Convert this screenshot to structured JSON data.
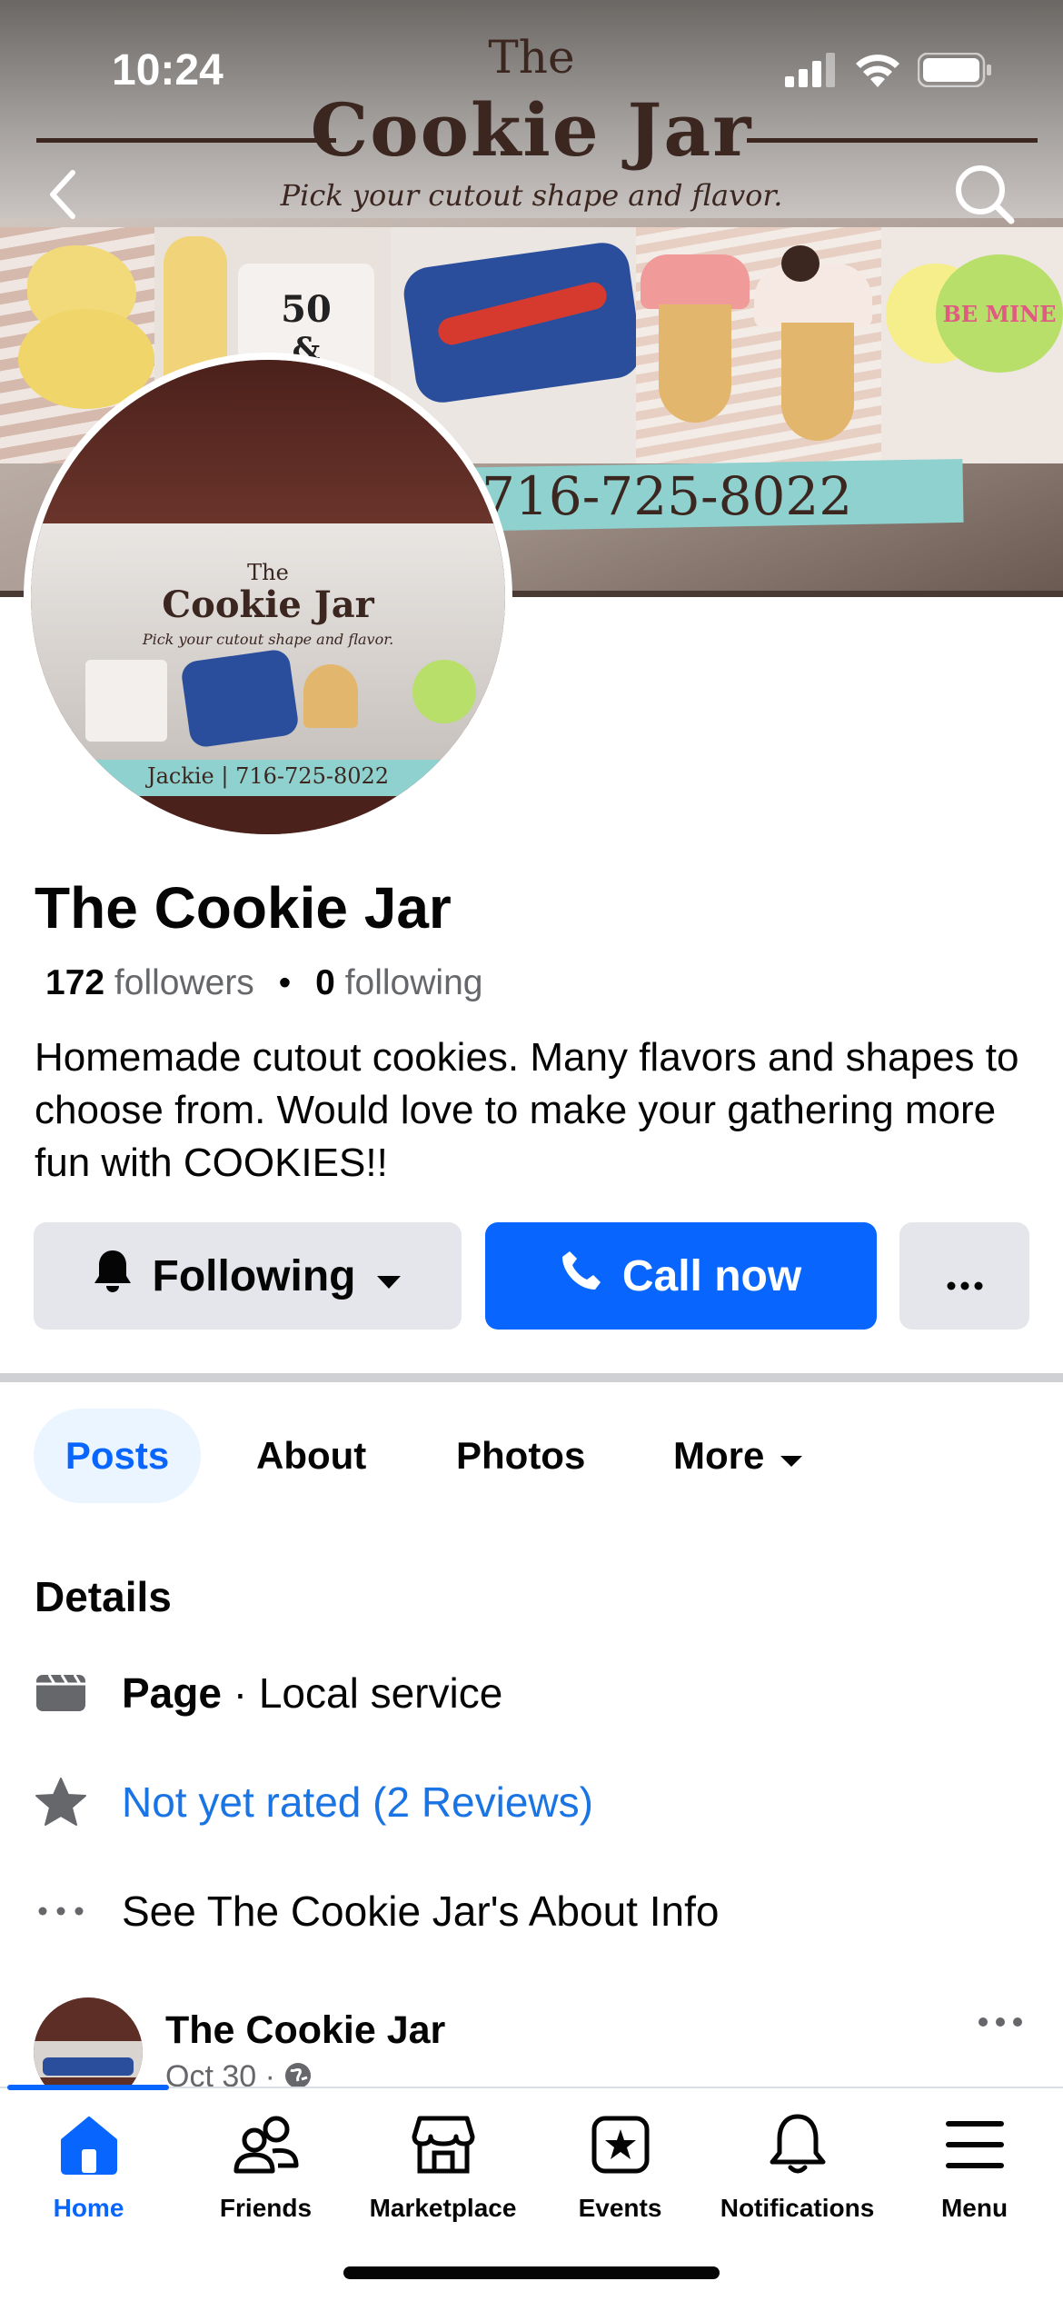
{
  "status_bar": {
    "time": "10:24"
  },
  "cover": {
    "title_small": "The",
    "title_big": "Cookie Jar",
    "tagline": "Pick your cutout shape and flavor.",
    "phone": "716-725-8022",
    "cookie_text_50": "50",
    "cookie_text_amp": "&",
    "heart_text": "BE MINE"
  },
  "avatar": {
    "title_small": "The",
    "title_big": "Cookie Jar",
    "tagline": "Pick your cutout shape and flavor.",
    "footer": "Jackie | 716-725-8022"
  },
  "profile": {
    "name": "The Cookie Jar",
    "followers_count": "172",
    "followers_label": "followers",
    "separator": "•",
    "following_count": "0",
    "following_label": "following",
    "bio": "Homemade cutout cookies. Many flavors and shapes to choose from. Would love to make your gathering more fun with COOKIES!!"
  },
  "actions": {
    "following_label": "Following",
    "call_label": "Call now",
    "more_label": "···"
  },
  "tabs": [
    {
      "label": "Posts",
      "active": true
    },
    {
      "label": "About"
    },
    {
      "label": "Photos"
    },
    {
      "label": "More"
    }
  ],
  "details": {
    "heading": "Details",
    "page_type_bold": "Page",
    "page_type_rest": " · Local service",
    "rating": "Not yet rated (2 Reviews)",
    "about_link": "See The Cookie Jar's About Info"
  },
  "post": {
    "author": "The Cookie Jar",
    "date": "Oct 30 · "
  },
  "bottom_nav": [
    {
      "label": "Home",
      "icon": "home-icon",
      "active": true
    },
    {
      "label": "Friends",
      "icon": "friends-icon"
    },
    {
      "label": "Marketplace",
      "icon": "marketplace-icon"
    },
    {
      "label": "Events",
      "icon": "events-icon"
    },
    {
      "label": "Notifications",
      "icon": "bell-icon"
    },
    {
      "label": "Menu",
      "icon": "menu-icon"
    }
  ],
  "colors": {
    "accent": "#0866ff",
    "tab_active_bg": "#ebf5ff",
    "button_gray": "#e4e6eb",
    "secondary_text": "#65676b"
  }
}
